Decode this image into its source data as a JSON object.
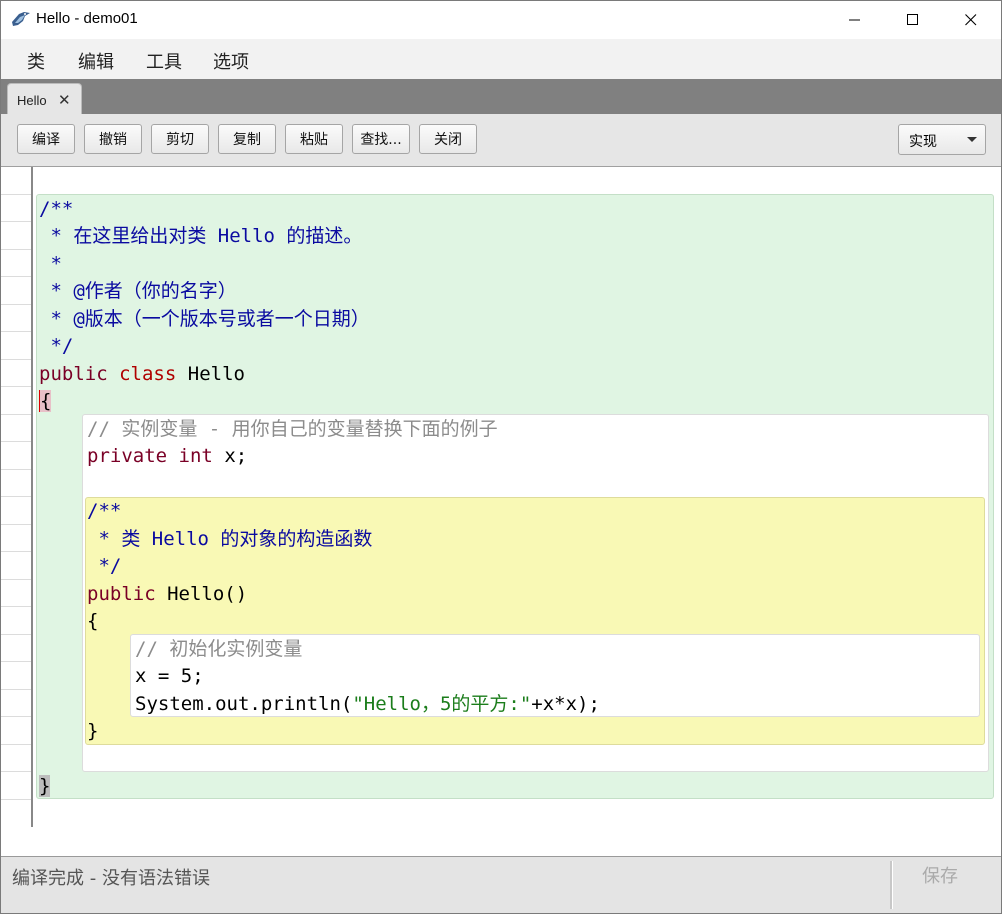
{
  "window": {
    "title": "Hello - demo01"
  },
  "menu": {
    "items": [
      "类",
      "编辑",
      "工具",
      "选项"
    ]
  },
  "tabs": [
    {
      "label": "Hello",
      "close": "✕"
    }
  ],
  "toolbar": {
    "buttons": [
      "编译",
      "撤销",
      "剪切",
      "复制",
      "粘贴",
      "查找...",
      "关闭"
    ],
    "view_select": "实现"
  },
  "code": {
    "doc_open": "/**",
    "doc_line1_pre": " * 在这里给出对类 ",
    "doc_line1_name": "Hello",
    "doc_line1_post": " 的描述。",
    "doc_line2": " *",
    "doc_line3": " * @作者（你的名字）",
    "doc_line4": " * @版本（一个版本号或者一个日期）",
    "doc_close": " */",
    "class_kw_public": "public",
    "class_kw_class": "class",
    "class_name": "Hello",
    "open_brace": "{",
    "field_comment": "// 实例变量 - 用你自己的变量替换下面的例子",
    "field_kw_private": "private",
    "field_kw_int": "int",
    "field_rest": "x;",
    "ctor_doc_open": "/**",
    "ctor_doc_line": " * 类 Hello 的对象的构造函数",
    "ctor_doc_close": " */",
    "ctor_kw_public": "public",
    "ctor_sig": "Hello()",
    "ctor_open": "{",
    "body_comment": "// 初始化实例变量",
    "body_line1": "x = 5;",
    "body_line2_pre": "System.out.println(",
    "body_line2_str": "\"Hello，5的平方:\"",
    "body_line2_post": "+x*x);",
    "ctor_close": "}",
    "close_brace": "}"
  },
  "status": {
    "message": "编译完成 - 没有语法错误",
    "save": "保存"
  },
  "colors": {
    "class_scope": "#e0f5e3",
    "method_scope": "#f9f9b5",
    "keyword": "#7a0026",
    "doc_comment": "#0a0aa0",
    "string": "#1b7d1b",
    "comment": "#8c8c8c"
  },
  "icons": {
    "app": "bluej-bird-icon",
    "minimize": "minimize-icon",
    "maximize": "maximize-icon",
    "close": "close-icon"
  }
}
